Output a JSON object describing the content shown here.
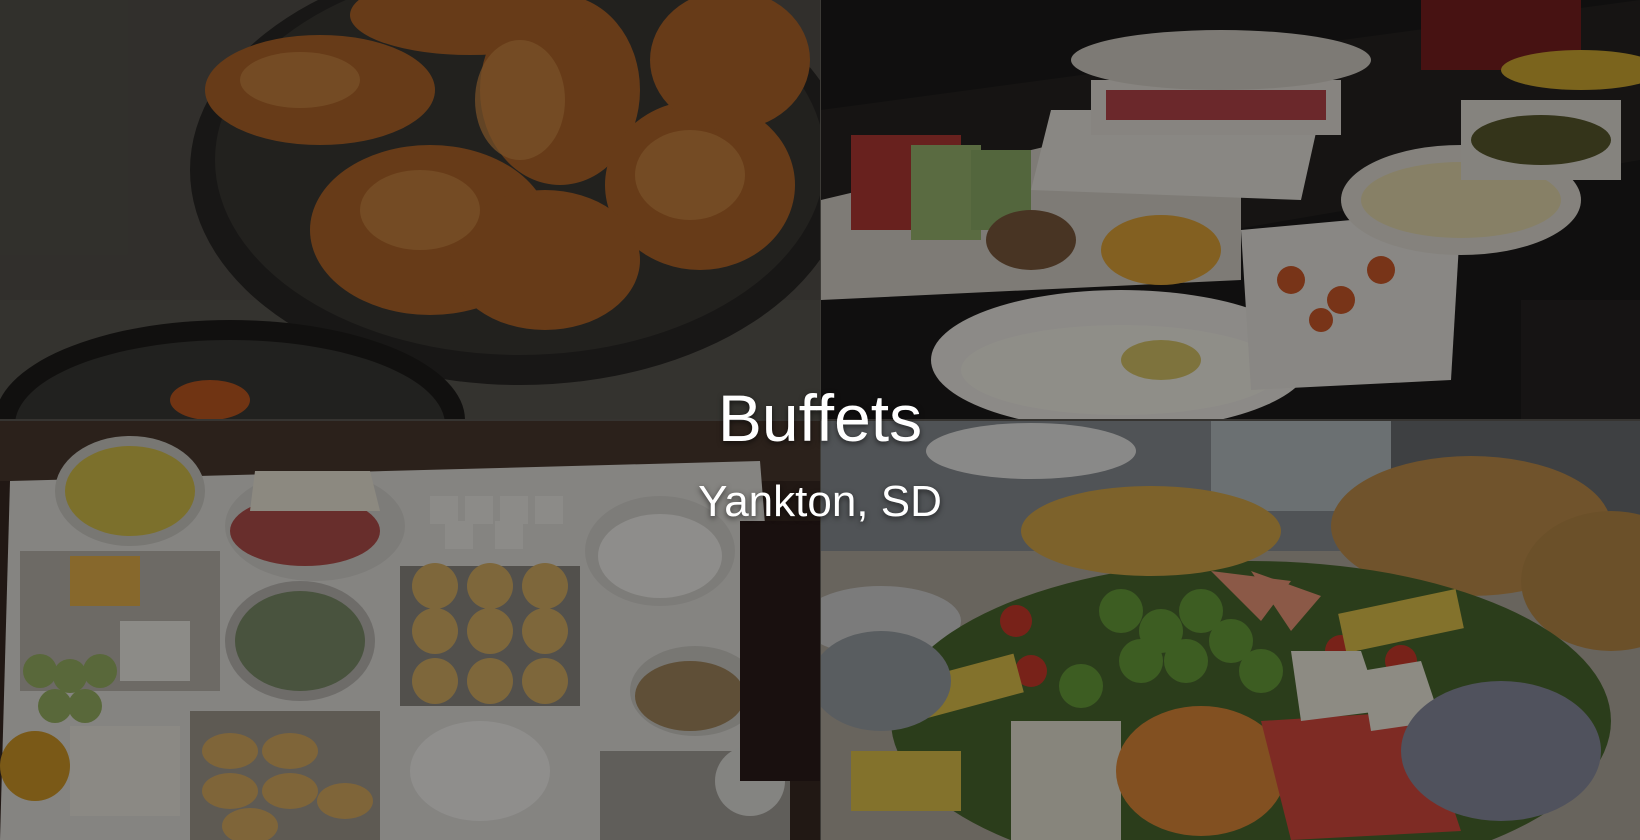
{
  "hero": {
    "title": "Buffets",
    "subtitle": "Yankton, SD"
  },
  "tiles": [
    {
      "icon": "fried-chicken-photo"
    },
    {
      "icon": "buffet-counter-photo"
    },
    {
      "icon": "breakfast-table-photo"
    },
    {
      "icon": "fruit-cheese-platter-photo"
    }
  ],
  "colors": {
    "overlay": "#000000",
    "text": "#ffffff"
  }
}
